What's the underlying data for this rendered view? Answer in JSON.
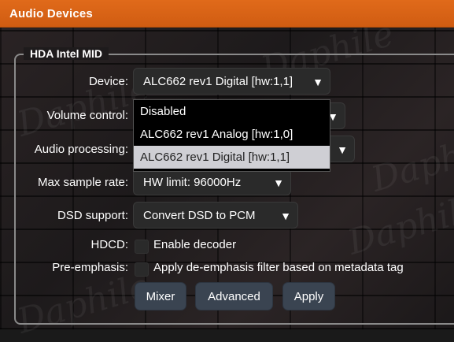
{
  "window": {
    "title": "Audio Devices"
  },
  "group": {
    "title": "HDA Intel MID"
  },
  "watermark_text": "Daphile",
  "fields": {
    "device": {
      "label": "Device:",
      "value": "ALC662 rev1 Digital [hw:1,1]"
    },
    "volume": {
      "label": "Volume control:"
    },
    "processing": {
      "label": "Audio processing:"
    },
    "samplerate": {
      "label": "Max sample rate:",
      "value": "HW limit: 96000Hz"
    },
    "dsd": {
      "label": "DSD support:",
      "value": "Convert DSD to PCM"
    },
    "hdcd": {
      "label": "HDCD:",
      "option": "Enable decoder",
      "checked": false
    },
    "preemphasis": {
      "label": "Pre-emphasis:",
      "option": "Apply de-emphasis filter based on metadata tag",
      "checked": false
    }
  },
  "device_dropdown": {
    "open": true,
    "options": [
      "Disabled",
      "ALC662 rev1 Analog [hw:1,0]",
      "ALC662 rev1 Digital [hw:1,1]"
    ],
    "selected_index": 2
  },
  "buttons": {
    "mixer": "Mixer",
    "advanced": "Advanced",
    "apply": "Apply"
  },
  "colors": {
    "titlebar": "#e06a1a",
    "button": "#3a4451",
    "dropdown_selected": "#cfcfd4"
  }
}
